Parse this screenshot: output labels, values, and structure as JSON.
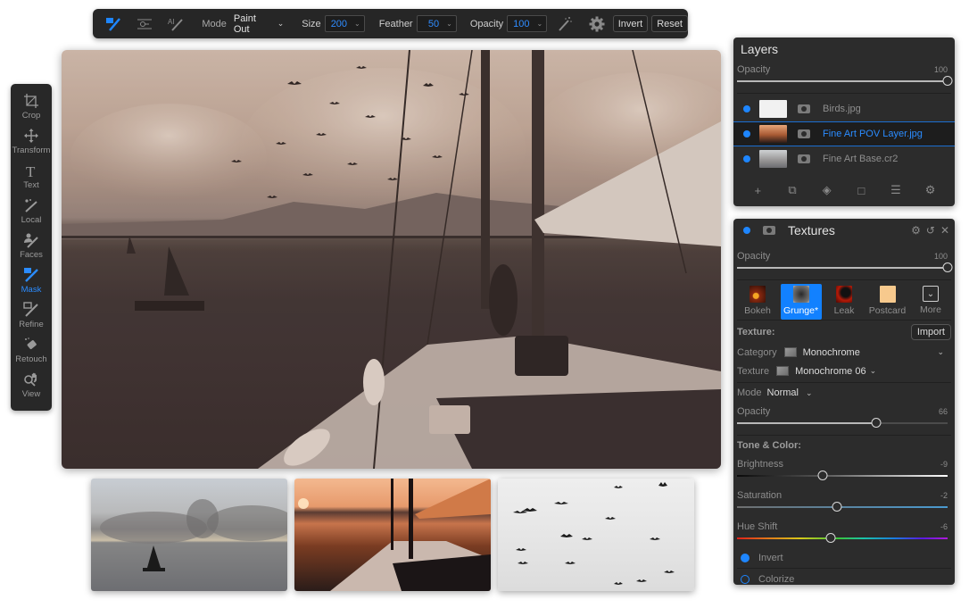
{
  "toolbar": {
    "tools": [
      {
        "name": "mask-brush",
        "active": true
      },
      {
        "name": "mask-line",
        "active": false
      },
      {
        "name": "ai-mask",
        "active": false
      }
    ],
    "mode_label": "Mode",
    "mode_value": "Paint Out",
    "size_label": "Size",
    "size_value": "200",
    "feather_label": "Feather",
    "feather_value": "50",
    "opacity_label": "Opacity",
    "opacity_value": "100",
    "invert_label": "Invert",
    "reset_label": "Reset"
  },
  "tool_strip": [
    {
      "label": "Crop",
      "icon": "crop-icon",
      "active": false
    },
    {
      "label": "Transform",
      "icon": "transform-icon",
      "active": false
    },
    {
      "label": "Text",
      "icon": "text-icon",
      "active": false
    },
    {
      "label": "Local",
      "icon": "local-icon",
      "active": false
    },
    {
      "label": "Faces",
      "icon": "faces-icon",
      "active": false
    },
    {
      "label": "Mask",
      "icon": "mask-icon",
      "active": true
    },
    {
      "label": "Refine",
      "icon": "refine-icon",
      "active": false
    },
    {
      "label": "Retouch",
      "icon": "retouch-icon",
      "active": false
    },
    {
      "label": "View",
      "icon": "view-icon",
      "active": false
    }
  ],
  "layers": {
    "title": "Layers",
    "opacity_label": "Opacity",
    "opacity_value": "100",
    "opacity_fraction": 1.0,
    "items": [
      {
        "name": "Birds.jpg",
        "selected": false
      },
      {
        "name": "Fine Art POV Layer.jpg",
        "selected": true
      },
      {
        "name": "Fine Art Base.cr2",
        "selected": false
      }
    ],
    "actions": [
      "add-layer",
      "duplicate-layer",
      "fill-layer",
      "new-document",
      "stack-layers",
      "layer-settings"
    ]
  },
  "textures": {
    "title": "Textures",
    "opacity_label": "Opacity",
    "opacity_value": "100",
    "opacity_fraction": 1.0,
    "presets": [
      {
        "label": "Bokeh",
        "active": false
      },
      {
        "label": "Grunge*",
        "active": true
      },
      {
        "label": "Leak",
        "active": false
      },
      {
        "label": "Postcard",
        "active": false
      },
      {
        "label": "More",
        "active": false
      }
    ],
    "texture_heading": "Texture:",
    "import_label": "Import",
    "category_label": "Category",
    "category_value": "Monochrome",
    "texture_label": "Texture",
    "texture_value": "Monochrome 06",
    "mode_label": "Mode",
    "mode_value": "Normal",
    "opacity2_label": "Opacity",
    "opacity2_value": "66",
    "opacity2_fraction": 0.66,
    "tone_heading": "Tone & Color:",
    "brightness_label": "Brightness",
    "brightness_value": "-9",
    "saturation_label": "Saturation",
    "saturation_value": "-2",
    "hue_label": "Hue Shift",
    "hue_value": "-6",
    "invert_label": "Invert",
    "invert_on": true,
    "colorize_label": "Colorize",
    "colorize_on": false
  },
  "images": {
    "main": "Sepia grunge composite of a sailboat deck looking toward a sailboat and mountains, with birds in the sky",
    "thumbnails": [
      "Fine Art Base – sailboat at sea under clouds",
      "Fine Art POV – sunset view from sailboat deck",
      "Birds – flock of birds against white sky"
    ]
  }
}
